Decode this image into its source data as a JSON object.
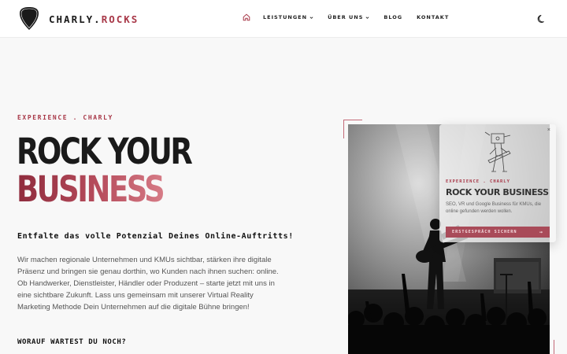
{
  "header": {
    "logo_text": "CHARLY ROCKS",
    "brand_part1": "CHARLY.",
    "brand_part2": "ROCKS",
    "nav": [
      {
        "label": "LEISTUNGEN",
        "dropdown": true
      },
      {
        "label": "ÜBER UNS",
        "dropdown": true
      },
      {
        "label": "BLOG",
        "dropdown": false
      },
      {
        "label": "KONTAKT",
        "dropdown": false
      }
    ],
    "icons": [
      "home-icon",
      "moon-icon"
    ]
  },
  "hero": {
    "kicker": "EXPERIENCE . CHARLY",
    "headline_line1": "ROCK YOUR",
    "headline_line2": "BUSINESS",
    "subheadline": "Entfalte das volle Potenzial Deines Online-Auftritts!",
    "intro": "Wir machen regionale Unternehmen und KMUs sichtbar, stärken ihre digitale Präsenz und bringen sie genau dorthin, wo Kunden nach ihnen suchen: online. Ob Handwerker, Dienstleister, Händler oder Produzent – starte jetzt mit uns in eine sichtbare Zukunft. Lass uns gemeinsam mit unserer Virtual Reality Marketing Methode Dein Unternehmen auf die digitale Bühne bringen!",
    "cta_question": "WORAUF WARTEST DU NOCH?"
  },
  "popup": {
    "close": "×",
    "kicker": "EXPERIENCE . CHARLY",
    "title": "ROCK YOUR BUSINESS",
    "description": "SEO, VR und Google Business für KMUs, die online gefunden werden wollen.",
    "button_label": "ERSTGESPRÄCH SICHERN",
    "button_arrow": "→"
  },
  "colors": {
    "accent": "#a83848",
    "accent_light": "#d67b86",
    "text": "#1a1a1a",
    "background": "#f8f8f8"
  }
}
